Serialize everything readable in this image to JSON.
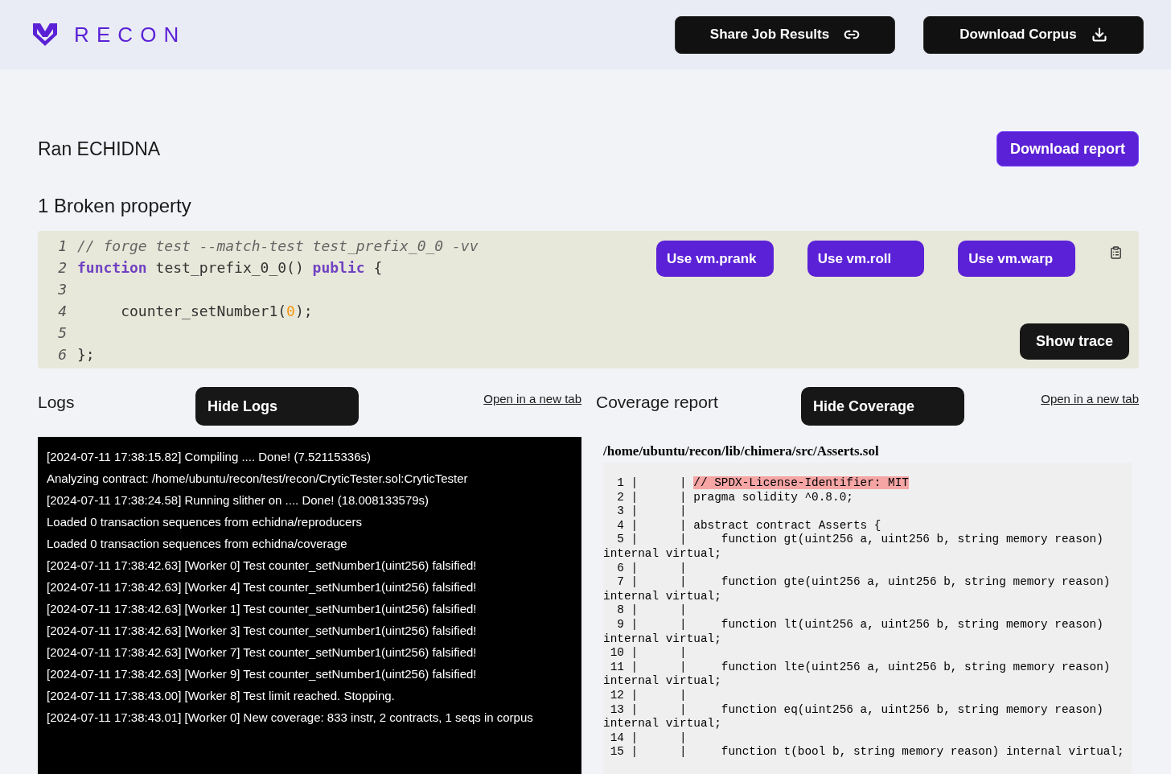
{
  "header": {
    "brand": "RECON",
    "buttons": [
      {
        "label": "Share Job Results"
      },
      {
        "label": "Download Corpus"
      }
    ]
  },
  "job": {
    "title": "Ran ECHIDNA",
    "report_button": "Download report"
  },
  "broken": {
    "heading": "1 Broken property",
    "code_lines": [
      {
        "number": "1",
        "tokens": [
          {
            "kind": "comment",
            "text": "// forge test --match-test test_prefix_0_0 -vv"
          }
        ]
      },
      {
        "number": "2",
        "tokens": [
          {
            "kind": "keyword",
            "text": "function"
          },
          {
            "kind": "plain",
            "text": " test_prefix_0_0() "
          },
          {
            "kind": "keyword",
            "text": "public"
          },
          {
            "kind": "plain",
            "text": " {"
          }
        ]
      },
      {
        "number": "3"
      },
      {
        "number": "4",
        "tokens": [
          {
            "kind": "plain",
            "text": "     counter_setNumber1("
          },
          {
            "kind": "number",
            "text": "0"
          },
          {
            "kind": "plain",
            "text": ");"
          }
        ]
      },
      {
        "number": "5"
      },
      {
        "number": "6",
        "tokens": [
          {
            "kind": "plain",
            "text": "};"
          }
        ]
      }
    ],
    "actions": [
      "Use vm.prank",
      "Use vm.roll",
      "Use vm.warp"
    ],
    "trace_button": "Show trace"
  },
  "logs": {
    "title": "Logs",
    "toggle": "Hide Logs",
    "link": "Open in a new tab",
    "lines": [
      "[2024-07-11 17:38:15.82] Compiling .... Done! (7.52115336s)",
      "Analyzing contract: /home/ubuntu/recon/test/recon/CryticTester.sol:CryticTester",
      "[2024-07-11 17:38:24.58] Running slither on .... Done! (18.008133579s)",
      "Loaded 0 transaction sequences from echidna/reproducers",
      "Loaded 0 transaction sequences from echidna/coverage",
      "[2024-07-11 17:38:42.63] [Worker 0] Test counter_setNumber1(uint256) falsified!",
      "[2024-07-11 17:38:42.63] [Worker 4] Test counter_setNumber1(uint256) falsified!",
      "[2024-07-11 17:38:42.63] [Worker 1] Test counter_setNumber1(uint256) falsified!",
      "[2024-07-11 17:38:42.63] [Worker 3] Test counter_setNumber1(uint256) falsified!",
      "[2024-07-11 17:38:42.63] [Worker 7] Test counter_setNumber1(uint256) falsified!",
      "[2024-07-11 17:38:42.63] [Worker 9] Test counter_setNumber1(uint256) falsified!",
      "[2024-07-11 17:38:43.00] [Worker 8] Test limit reached. Stopping.",
      "[2024-07-11 17:38:43.01] [Worker 0] New coverage: 833 instr, 2 contracts, 1 seqs in corpus"
    ]
  },
  "coverage": {
    "title": "Coverage report",
    "toggle": "Hide Coverage",
    "link": "Open in a new tab",
    "file": "/home/ubuntu/recon/lib/chimera/src/Asserts.sol",
    "lines": [
      {
        "gutter": "  1 |      | ",
        "code": "// SPDX-License-Identifier: MIT",
        "highlighted": true
      },
      {
        "gutter": "  2 |      | ",
        "code": "pragma solidity ^0.8.0;",
        "highlighted": false
      },
      {
        "gutter": "  3 |      |"
      },
      {
        "gutter": "  4 |      | ",
        "code": "abstract contract Asserts {",
        "highlighted": false
      },
      {
        "gutter": "  5 |      | ",
        "code": "    function gt(uint256 a, uint256 b, string memory reason) internal virtual;",
        "highlighted": false
      },
      {
        "gutter": "  6 |      |"
      },
      {
        "gutter": "  7 |      | ",
        "code": "    function gte(uint256 a, uint256 b, string memory reason) internal virtual;",
        "highlighted": false
      },
      {
        "gutter": "  8 |      |"
      },
      {
        "gutter": "  9 |      | ",
        "code": "    function lt(uint256 a, uint256 b, string memory reason) internal virtual;",
        "highlighted": false
      },
      {
        "gutter": " 10 |      |"
      },
      {
        "gutter": " 11 |      | ",
        "code": "    function lte(uint256 a, uint256 b, string memory reason) internal virtual;",
        "highlighted": false
      },
      {
        "gutter": " 12 |      |"
      },
      {
        "gutter": " 13 |      | ",
        "code": "    function eq(uint256 a, uint256 b, string memory reason) internal virtual;",
        "highlighted": false
      },
      {
        "gutter": " 14 |      |"
      },
      {
        "gutter": " 15 |      | ",
        "code": "    function t(bool b, string memory reason) internal virtual;",
        "highlighted": false
      }
    ]
  }
}
